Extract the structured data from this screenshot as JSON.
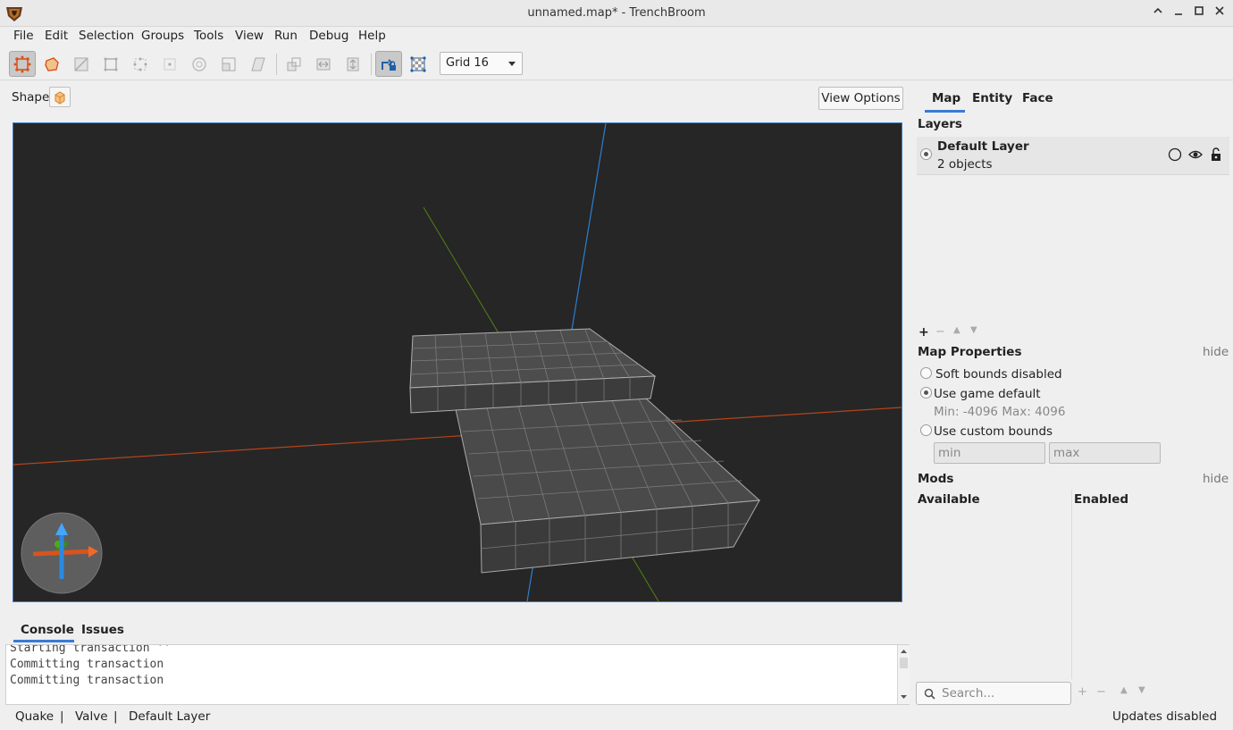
{
  "window": {
    "title": "unnamed.map* - TrenchBroom"
  },
  "menu": [
    "File",
    "Edit",
    "Selection",
    "Groups",
    "Tools",
    "View",
    "Run",
    "Debug",
    "Help"
  ],
  "toolbar": {
    "grid_label": "Grid 16"
  },
  "shape": {
    "label": "Shape"
  },
  "view_options": {
    "label": "View Options"
  },
  "console": {
    "tabs": [
      "Console",
      "Issues"
    ],
    "lines": [
      "Starting transaction ''",
      "Committing transaction",
      "Committing transaction"
    ]
  },
  "status": {
    "game": "Quake",
    "sep1": "|",
    "engine": "Valve",
    "sep2": "|",
    "layer": "Default Layer",
    "updates": "Updates disabled"
  },
  "inspector": {
    "tabs": [
      "Map",
      "Entity",
      "Face"
    ],
    "layers": {
      "title": "Layers",
      "items": [
        {
          "name": "Default Layer",
          "count": "2 objects"
        }
      ]
    },
    "map_properties": {
      "title": "Map Properties",
      "hide": "hide",
      "options": [
        "Soft bounds disabled",
        "Use game default",
        "Use custom bounds"
      ],
      "game_default_range": "Min: -4096 Max: 4096",
      "min_placeholder": "min",
      "max_placeholder": "max"
    },
    "mods": {
      "title": "Mods",
      "hide": "hide",
      "available": "Available",
      "enabled": "Enabled",
      "search_placeholder": "Search..."
    }
  },
  "colors": {
    "accent": "#3a7bd5",
    "viewport_bg": "#262626",
    "x_axis": "#c84a1e",
    "y_axis": "#5a8a1a",
    "z_axis": "#2a7fd0"
  }
}
